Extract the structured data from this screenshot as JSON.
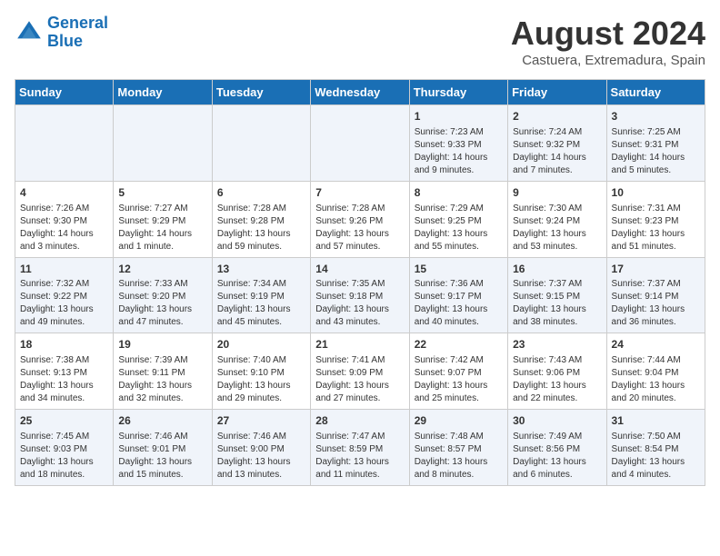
{
  "logo": {
    "line1": "General",
    "line2": "Blue"
  },
  "title": {
    "month_year": "August 2024",
    "location": "Castuera, Extremadura, Spain"
  },
  "days_of_week": [
    "Sunday",
    "Monday",
    "Tuesday",
    "Wednesday",
    "Thursday",
    "Friday",
    "Saturday"
  ],
  "weeks": [
    [
      {
        "day": "",
        "info": ""
      },
      {
        "day": "",
        "info": ""
      },
      {
        "day": "",
        "info": ""
      },
      {
        "day": "",
        "info": ""
      },
      {
        "day": "1",
        "info": "Sunrise: 7:23 AM\nSunset: 9:33 PM\nDaylight: 14 hours and 9 minutes."
      },
      {
        "day": "2",
        "info": "Sunrise: 7:24 AM\nSunset: 9:32 PM\nDaylight: 14 hours and 7 minutes."
      },
      {
        "day": "3",
        "info": "Sunrise: 7:25 AM\nSunset: 9:31 PM\nDaylight: 14 hours and 5 minutes."
      }
    ],
    [
      {
        "day": "4",
        "info": "Sunrise: 7:26 AM\nSunset: 9:30 PM\nDaylight: 14 hours and 3 minutes."
      },
      {
        "day": "5",
        "info": "Sunrise: 7:27 AM\nSunset: 9:29 PM\nDaylight: 14 hours and 1 minute."
      },
      {
        "day": "6",
        "info": "Sunrise: 7:28 AM\nSunset: 9:28 PM\nDaylight: 13 hours and 59 minutes."
      },
      {
        "day": "7",
        "info": "Sunrise: 7:28 AM\nSunset: 9:26 PM\nDaylight: 13 hours and 57 minutes."
      },
      {
        "day": "8",
        "info": "Sunrise: 7:29 AM\nSunset: 9:25 PM\nDaylight: 13 hours and 55 minutes."
      },
      {
        "day": "9",
        "info": "Sunrise: 7:30 AM\nSunset: 9:24 PM\nDaylight: 13 hours and 53 minutes."
      },
      {
        "day": "10",
        "info": "Sunrise: 7:31 AM\nSunset: 9:23 PM\nDaylight: 13 hours and 51 minutes."
      }
    ],
    [
      {
        "day": "11",
        "info": "Sunrise: 7:32 AM\nSunset: 9:22 PM\nDaylight: 13 hours and 49 minutes."
      },
      {
        "day": "12",
        "info": "Sunrise: 7:33 AM\nSunset: 9:20 PM\nDaylight: 13 hours and 47 minutes."
      },
      {
        "day": "13",
        "info": "Sunrise: 7:34 AM\nSunset: 9:19 PM\nDaylight: 13 hours and 45 minutes."
      },
      {
        "day": "14",
        "info": "Sunrise: 7:35 AM\nSunset: 9:18 PM\nDaylight: 13 hours and 43 minutes."
      },
      {
        "day": "15",
        "info": "Sunrise: 7:36 AM\nSunset: 9:17 PM\nDaylight: 13 hours and 40 minutes."
      },
      {
        "day": "16",
        "info": "Sunrise: 7:37 AM\nSunset: 9:15 PM\nDaylight: 13 hours and 38 minutes."
      },
      {
        "day": "17",
        "info": "Sunrise: 7:37 AM\nSunset: 9:14 PM\nDaylight: 13 hours and 36 minutes."
      }
    ],
    [
      {
        "day": "18",
        "info": "Sunrise: 7:38 AM\nSunset: 9:13 PM\nDaylight: 13 hours and 34 minutes."
      },
      {
        "day": "19",
        "info": "Sunrise: 7:39 AM\nSunset: 9:11 PM\nDaylight: 13 hours and 32 minutes."
      },
      {
        "day": "20",
        "info": "Sunrise: 7:40 AM\nSunset: 9:10 PM\nDaylight: 13 hours and 29 minutes."
      },
      {
        "day": "21",
        "info": "Sunrise: 7:41 AM\nSunset: 9:09 PM\nDaylight: 13 hours and 27 minutes."
      },
      {
        "day": "22",
        "info": "Sunrise: 7:42 AM\nSunset: 9:07 PM\nDaylight: 13 hours and 25 minutes."
      },
      {
        "day": "23",
        "info": "Sunrise: 7:43 AM\nSunset: 9:06 PM\nDaylight: 13 hours and 22 minutes."
      },
      {
        "day": "24",
        "info": "Sunrise: 7:44 AM\nSunset: 9:04 PM\nDaylight: 13 hours and 20 minutes."
      }
    ],
    [
      {
        "day": "25",
        "info": "Sunrise: 7:45 AM\nSunset: 9:03 PM\nDaylight: 13 hours and 18 minutes."
      },
      {
        "day": "26",
        "info": "Sunrise: 7:46 AM\nSunset: 9:01 PM\nDaylight: 13 hours and 15 minutes."
      },
      {
        "day": "27",
        "info": "Sunrise: 7:46 AM\nSunset: 9:00 PM\nDaylight: 13 hours and 13 minutes."
      },
      {
        "day": "28",
        "info": "Sunrise: 7:47 AM\nSunset: 8:59 PM\nDaylight: 13 hours and 11 minutes."
      },
      {
        "day": "29",
        "info": "Sunrise: 7:48 AM\nSunset: 8:57 PM\nDaylight: 13 hours and 8 minutes."
      },
      {
        "day": "30",
        "info": "Sunrise: 7:49 AM\nSunset: 8:56 PM\nDaylight: 13 hours and 6 minutes."
      },
      {
        "day": "31",
        "info": "Sunrise: 7:50 AM\nSunset: 8:54 PM\nDaylight: 13 hours and 4 minutes."
      }
    ]
  ]
}
